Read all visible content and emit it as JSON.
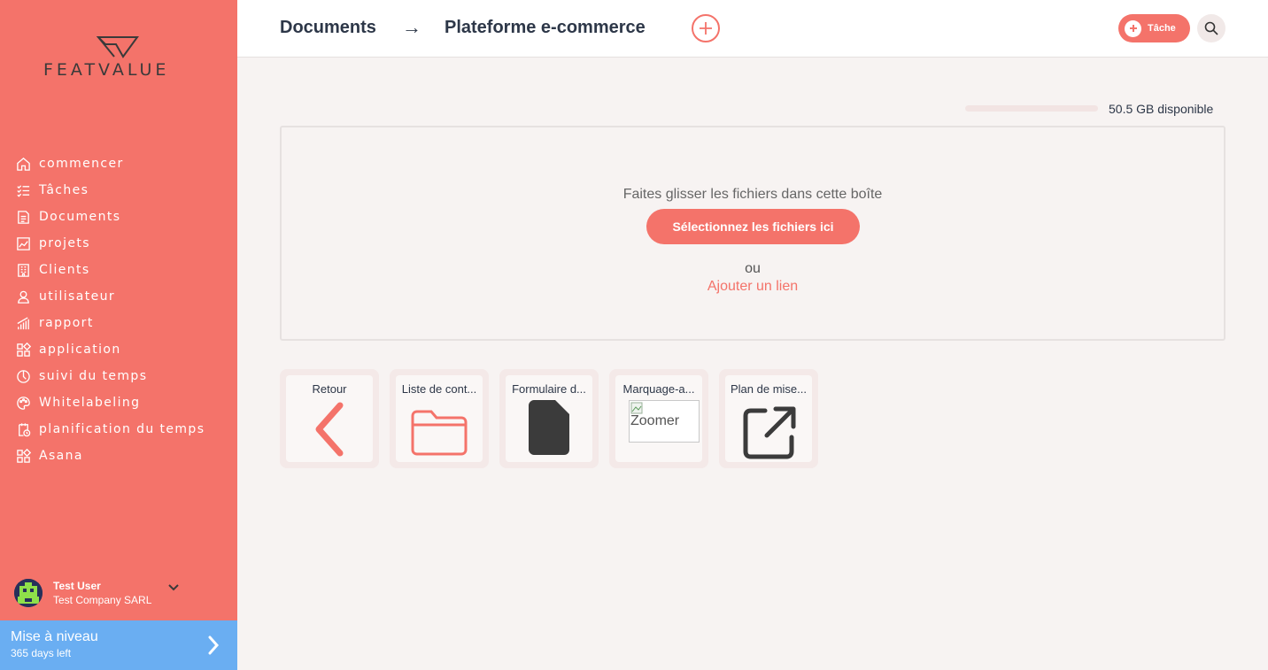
{
  "brand": {
    "name": "FEATVALUE",
    "accent": "#f4736a",
    "upgrade_color": "#6aaef2"
  },
  "sidebar": {
    "items": [
      {
        "label": "commencer",
        "icon": "home-icon"
      },
      {
        "label": "Tâches",
        "icon": "checklist-icon"
      },
      {
        "label": "Documents",
        "icon": "document-icon"
      },
      {
        "label": "projets",
        "icon": "chart-icon"
      },
      {
        "label": "Clients",
        "icon": "building-icon"
      },
      {
        "label": "utilisateur",
        "icon": "user-icon"
      },
      {
        "label": "rapport",
        "icon": "bar-chart-icon"
      },
      {
        "label": "application",
        "icon": "apps-icon"
      },
      {
        "label": "suivi du temps",
        "icon": "timer-icon"
      },
      {
        "label": "Whitelabeling",
        "icon": "palette-icon"
      },
      {
        "label": "planification du temps",
        "icon": "schedule-icon"
      },
      {
        "label": "Asana",
        "icon": "apps-icon"
      }
    ],
    "user": {
      "name": "Test User",
      "company": "Test Company SARL"
    },
    "upgrade": {
      "title": "Mise à niveau",
      "subtitle": "365 days left"
    }
  },
  "header": {
    "breadcrumb": [
      "Documents",
      "Plateforme e-commerce"
    ],
    "arrow": "→",
    "task_label": "Tâche"
  },
  "storage": {
    "text": "50.5 GB disponible"
  },
  "dropzone": {
    "text": "Faites glisser les fichiers dans cette boîte",
    "button": "Sélectionnez les fichiers ici",
    "or": "ou",
    "link": "Ajouter un lien"
  },
  "tiles": [
    {
      "title": "Retour",
      "icon": "chevron-left-icon"
    },
    {
      "title": "Liste de cont...",
      "icon": "folder-icon"
    },
    {
      "title": "Formulaire d...",
      "icon": "file-icon"
    },
    {
      "title": "Marquage-a...",
      "image_alt": "Zoomer"
    },
    {
      "title": "Plan de mise...",
      "icon": "external-link-icon"
    }
  ]
}
